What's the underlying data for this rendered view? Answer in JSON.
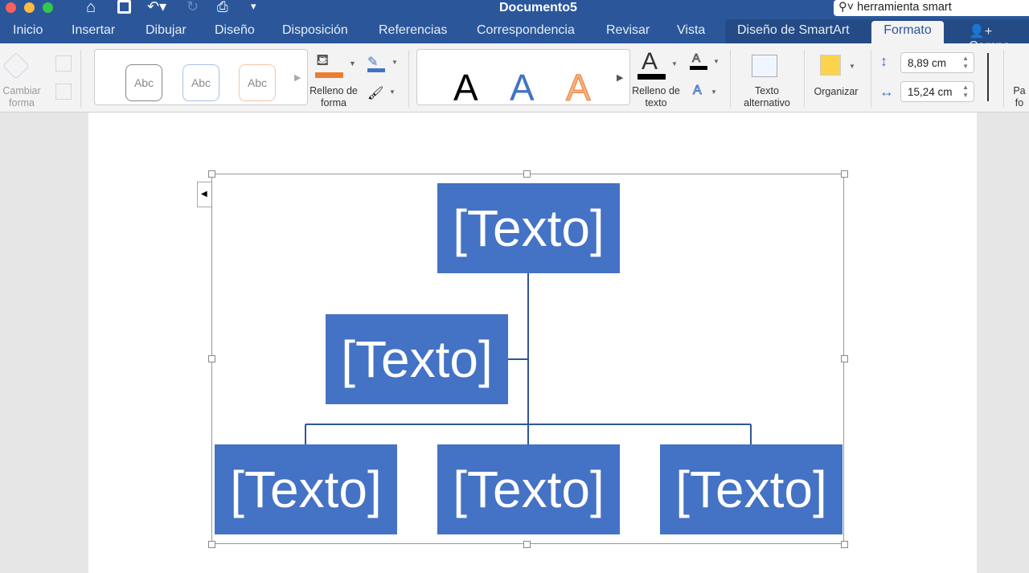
{
  "window": {
    "title": "Documento5",
    "search_value": "herramienta smart"
  },
  "tabs": [
    "Inicio",
    "Insertar",
    "Dibujar",
    "Diseño",
    "Disposición",
    "Referencias",
    "Correspondencia",
    "Revisar",
    "Vista",
    "Diseño de SmartArt",
    "Formato"
  ],
  "share_label": "Compa",
  "ribbon": {
    "change_shape": "Cambiar forma",
    "shape_styles": [
      "Abc",
      "Abc",
      "Abc"
    ],
    "shape_fill": "Relleno de forma",
    "wordart": [
      "A",
      "A",
      "A"
    ],
    "text_fill": "Relleno de texto",
    "alt_text": "Texto alternativo",
    "arrange": "Organizar",
    "height": "8,89 cm",
    "width": "15,24 cm",
    "format_pane": "Pa fo"
  },
  "smartart": {
    "nodes": [
      "[Texto]",
      "[Texto]",
      "[Texto]",
      "[Texto]",
      "[Texto]"
    ]
  },
  "colors": {
    "accent": "#2b579a",
    "shape": "#4472c4"
  }
}
